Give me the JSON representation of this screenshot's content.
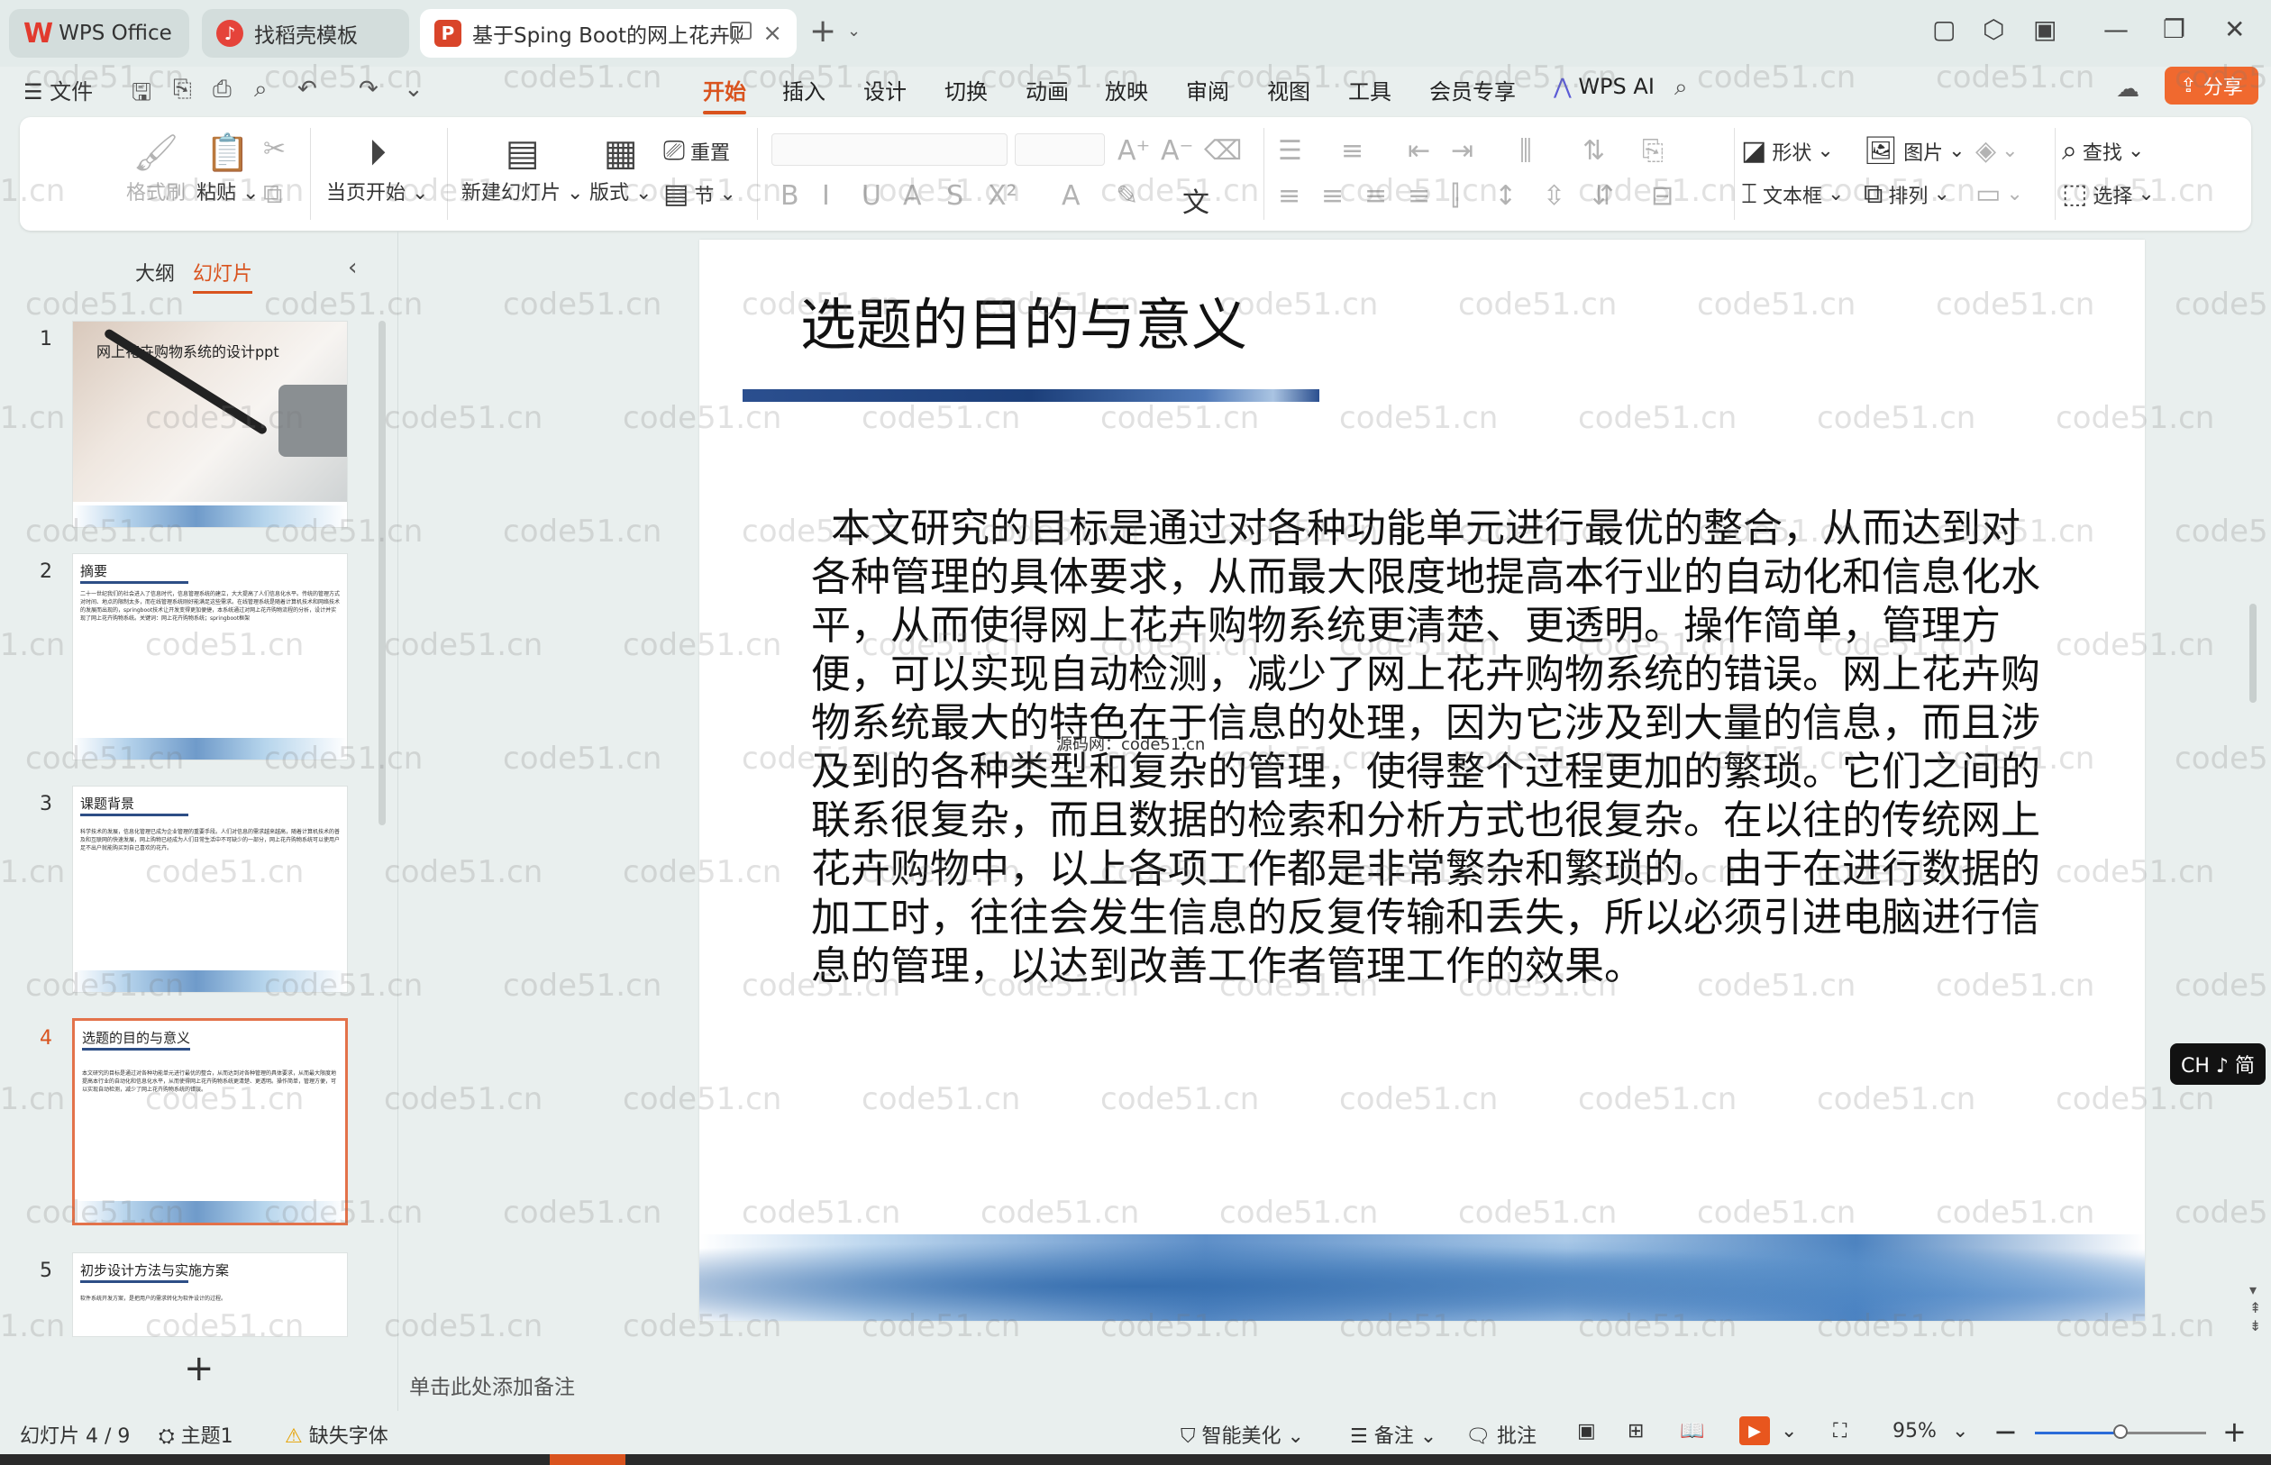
{
  "titlebar": {
    "tabs": [
      {
        "label": "WPS Office"
      },
      {
        "label": "找稻壳模板"
      },
      {
        "label": "基于Sping Boot的网上花卉购"
      }
    ]
  },
  "menu": {
    "file_label": "文件",
    "tabs": [
      "开始",
      "插入",
      "设计",
      "切换",
      "动画",
      "放映",
      "审阅",
      "视图",
      "工具",
      "会员专享",
      "WPS AI"
    ],
    "share_label": "分享"
  },
  "ribbon": {
    "format_painter": "格式刷",
    "paste": "粘贴",
    "play_from_current": "当页开始",
    "new_slide": "新建幻灯片",
    "layout": "版式",
    "reset": "重置",
    "section": "节",
    "shape": "形状",
    "picture": "图片",
    "textbox": "文本框",
    "arrange": "排列",
    "find": "查找",
    "select": "选择"
  },
  "panel": {
    "tab_outline": "大纲",
    "tab_slides": "幻灯片",
    "slides": [
      {
        "num": "1",
        "title": "网上花卉购物系统的设计ppt",
        "body": ""
      },
      {
        "num": "2",
        "title": "摘要",
        "body": "二十一世纪我们的社会进入了信息时代，信息管理系统的建立，大大提高了人们信息化水平。传统的管理方式对时间、地点的限制太多，而在线管理系统刚好能满足这些需求。在线管理系统是随着计算机技术和网络技术的发展而出现的，springboot技术让开发变得更加便捷，本系统通过对网上花卉购物流程的分析，设计并实现了网上花卉购物系统。关键词：网上花卉购物系统；springboot框架"
      },
      {
        "num": "3",
        "title": "课题背景",
        "body": "科学技术的发展，信息化管理已成为企业管理的重要手段。人们对信息的需求越来越高，随着计算机技术的普及和互联网的快速发展，网上购物已经成为人们日常生活中不可缺少的一部分，网上花卉购物系统可以使用户足不出户就能购买到自己喜欢的花卉。"
      },
      {
        "num": "4",
        "title": "选题的目的与意义",
        "body": "本文研究的目标是通过对各种功能单元进行最优的整合，从而达到对各种管理的具体要求，从而最大限度地提高本行业的自动化和信息化水平，从而使得网上花卉购物系统更清楚、更透明。操作简单，管理方便，可以实现自动检测，减少了网上花卉购物系统的错误。"
      },
      {
        "num": "5",
        "title": "初步设计方法与实施方案",
        "body": "软件系统开发方案，是把用户的需求转化为软件设计的过程。"
      }
    ]
  },
  "slide": {
    "title": "选题的目的与意义",
    "body": "本文研究的目标是通过对各种功能单元进行最优的整合，从而达到对各种管理的具体要求，从而最大限度地提高本行业的自动化和信息化水平，从而使得网上花卉购物系统更清楚、更透明。操作简单，管理方便，可以实现自动检测，减少了网上花卉购物系统的错误。网上花卉购物系统最大的特色在于信息的处理，因为它涉及到大量的信息，而且涉及到的各种类型和复杂的管理，使得整个过程更加的繁琐。它们之间的联系很复杂，而且数据的检索和分析方式也很复杂。在以往的传统网上花卉购物中，以上各项工作都是非常繁杂和繁琐的。由于在进行数据的加工时，往往会发生信息的反复传输和丢失，所以必须引进电脑进行信息的管理，以达到改善工作者管理工作的效果。",
    "inner_watermark": "源码网：code51.cn",
    "notes_placeholder": "单击此处添加备注"
  },
  "ime": {
    "label": "CH ♪ 简"
  },
  "status": {
    "slide_counter": "幻灯片 4 / 9",
    "theme": "主题1",
    "missing_font": "缺失字体",
    "smart_beautify": "智能美化",
    "notes": "备注",
    "comments": "批注",
    "zoom": "95%",
    "zoom_fraction": 0.5
  },
  "watermark": {
    "text": "code51.cn"
  },
  "colors": {
    "accent": "#d9531e",
    "share": "#f0692f"
  }
}
